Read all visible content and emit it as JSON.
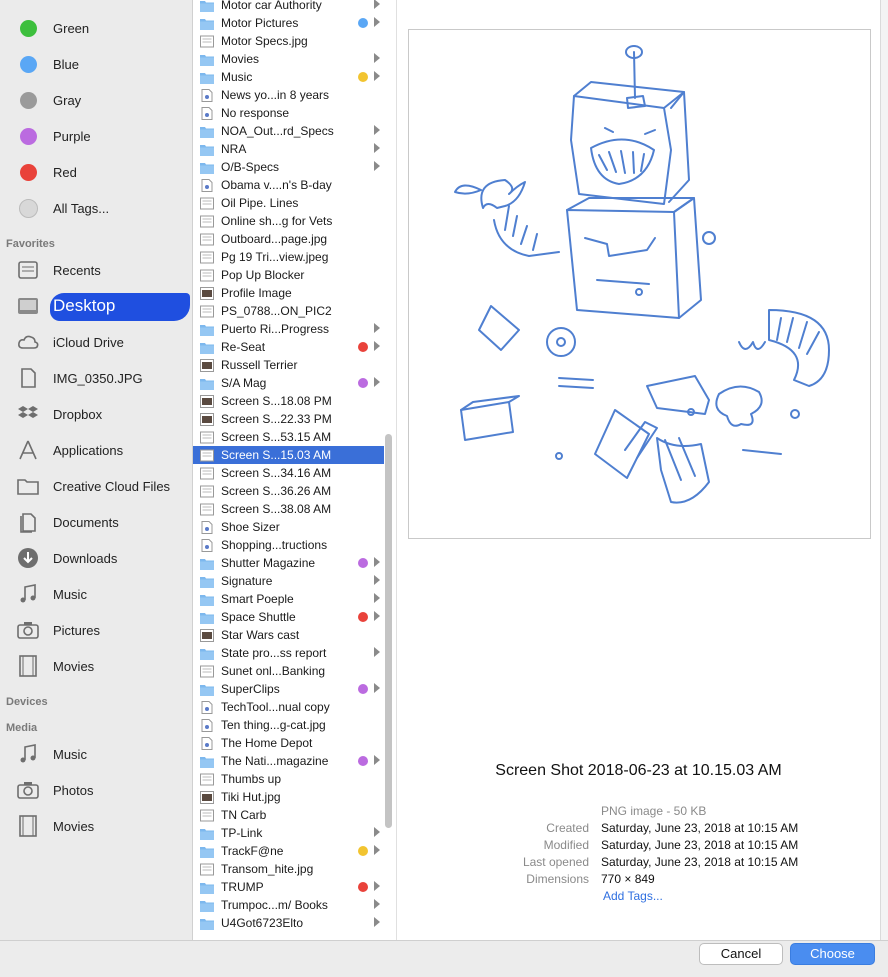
{
  "sidebar": {
    "tags": [
      {
        "label": "Green",
        "color": "#3dbf3d"
      },
      {
        "label": "Blue",
        "color": "#5aa7f5"
      },
      {
        "label": "Gray",
        "color": "#9a9a9a"
      },
      {
        "label": "Purple",
        "color": "#bb6be0"
      },
      {
        "label": "Red",
        "color": "#e9423a"
      },
      {
        "label": "All Tags...",
        "color": "#d8d8d8"
      }
    ],
    "favorites_header": "Favorites",
    "favorites": [
      {
        "label": "Recents",
        "icon": "recents-icon"
      },
      {
        "label": "Desktop",
        "icon": "desktop-icon",
        "selected": true
      },
      {
        "label": "iCloud Drive",
        "icon": "cloud-icon"
      },
      {
        "label": "IMG_0350.JPG",
        "icon": "document-icon"
      },
      {
        "label": "Dropbox",
        "icon": "dropbox-icon"
      },
      {
        "label": "Applications",
        "icon": "applications-icon"
      },
      {
        "label": "Creative Cloud Files",
        "icon": "folder-icon"
      },
      {
        "label": "Documents",
        "icon": "documents-icon"
      },
      {
        "label": "Downloads",
        "icon": "downloads-icon"
      },
      {
        "label": "Music",
        "icon": "music-icon"
      },
      {
        "label": "Pictures",
        "icon": "camera-icon"
      },
      {
        "label": "Movies",
        "icon": "film-icon"
      }
    ],
    "devices_header": "Devices",
    "media_header": "Media",
    "media": [
      {
        "label": "Music",
        "icon": "music-icon"
      },
      {
        "label": "Photos",
        "icon": "camera-icon"
      },
      {
        "label": "Movies",
        "icon": "film-icon"
      }
    ]
  },
  "files": [
    {
      "name": "Motor car Authority",
      "type": "folder",
      "arrow": true
    },
    {
      "name": "Motor Pictures",
      "type": "folder",
      "arrow": true,
      "tag": "#5aa7f5"
    },
    {
      "name": "Motor Specs.jpg",
      "type": "image"
    },
    {
      "name": "Movies",
      "type": "folder",
      "arrow": true
    },
    {
      "name": "Music",
      "type": "folder",
      "arrow": true,
      "tag": "#f2c430"
    },
    {
      "name": "News yo...in 8 years",
      "type": "doc"
    },
    {
      "name": "No response",
      "type": "doc"
    },
    {
      "name": "NOA_Out...rd_Specs",
      "type": "folder",
      "arrow": true
    },
    {
      "name": "NRA",
      "type": "folder",
      "arrow": true
    },
    {
      "name": "O/B-Specs",
      "type": "folder",
      "arrow": true
    },
    {
      "name": "Obama v....n's B-day",
      "type": "doc"
    },
    {
      "name": "Oil Pipe. Lines",
      "type": "image"
    },
    {
      "name": "Online sh...g for Vets",
      "type": "image"
    },
    {
      "name": "Outboard...page.jpg",
      "type": "image"
    },
    {
      "name": "Pg 19 Tri...view.jpeg",
      "type": "image"
    },
    {
      "name": "Pop Up Blocker",
      "type": "image"
    },
    {
      "name": "Profile Image",
      "type": "photo"
    },
    {
      "name": "PS_0788...ON_PIC2",
      "type": "image"
    },
    {
      "name": "Puerto Ri...Progress",
      "type": "folder",
      "arrow": true
    },
    {
      "name": "Re-Seat",
      "type": "folder",
      "arrow": true,
      "tag": "#e9423a"
    },
    {
      "name": "Russell Terrier",
      "type": "photo"
    },
    {
      "name": "S/A Mag",
      "type": "folder",
      "arrow": true,
      "tag": "#bb6be0"
    },
    {
      "name": "Screen S...18.08 PM",
      "type": "photo"
    },
    {
      "name": "Screen S...22.33 PM",
      "type": "photo"
    },
    {
      "name": "Screen S...53.15 AM",
      "type": "image"
    },
    {
      "name": "Screen S...15.03 AM",
      "type": "image",
      "selected": true
    },
    {
      "name": "Screen S...34.16 AM",
      "type": "image"
    },
    {
      "name": "Screen S...36.26 AM",
      "type": "image"
    },
    {
      "name": "Screen S...38.08 AM",
      "type": "image"
    },
    {
      "name": "Shoe Sizer",
      "type": "doc"
    },
    {
      "name": "Shopping...tructions",
      "type": "doc"
    },
    {
      "name": "Shutter Magazine",
      "type": "folder",
      "arrow": true,
      "tag": "#bb6be0"
    },
    {
      "name": "Signature",
      "type": "folder",
      "arrow": true
    },
    {
      "name": "Smart Poeple",
      "type": "folder",
      "arrow": true
    },
    {
      "name": "Space Shuttle",
      "type": "folder",
      "arrow": true,
      "tag": "#e9423a"
    },
    {
      "name": "Star Wars cast",
      "type": "photo"
    },
    {
      "name": "State pro...ss report",
      "type": "folder",
      "arrow": true
    },
    {
      "name": "Sunet onl...Banking",
      "type": "image"
    },
    {
      "name": "SuperClips",
      "type": "folder",
      "arrow": true,
      "tag": "#bb6be0"
    },
    {
      "name": "TechTool...nual copy",
      "type": "doc"
    },
    {
      "name": "Ten thing...g-cat.jpg",
      "type": "doc"
    },
    {
      "name": "The Home Depot",
      "type": "doc"
    },
    {
      "name": "The Nati...magazine",
      "type": "folder",
      "arrow": true,
      "tag": "#bb6be0"
    },
    {
      "name": "Thumbs up",
      "type": "image"
    },
    {
      "name": "Tiki Hut.jpg",
      "type": "photo"
    },
    {
      "name": "TN Carb",
      "type": "image"
    },
    {
      "name": "TP-Link",
      "type": "folder",
      "arrow": true
    },
    {
      "name": "TrackF@ne",
      "type": "folder",
      "arrow": true,
      "tag": "#f2c430"
    },
    {
      "name": "Transom_hite.jpg",
      "type": "image"
    },
    {
      "name": "TRUMP",
      "type": "folder",
      "arrow": true,
      "tag": "#e9423a"
    },
    {
      "name": "Trumpoc...m/ Books",
      "type": "folder",
      "arrow": true
    },
    {
      "name": "U4Got6723Elto",
      "type": "folder",
      "arrow": true
    }
  ],
  "preview": {
    "filename": "Screen Shot 2018-06-23 at 10.15.03 AM",
    "kind": "PNG image - 50 KB",
    "meta": [
      {
        "key": "Created",
        "value": "Saturday, June 23, 2018 at 10:15 AM"
      },
      {
        "key": "Modified",
        "value": "Saturday, June 23, 2018 at 10:15 AM"
      },
      {
        "key": "Last opened",
        "value": "Saturday, June 23, 2018 at 10:15 AM"
      },
      {
        "key": "Dimensions",
        "value": "770 × 849"
      }
    ],
    "add_tags": "Add Tags..."
  },
  "buttons": {
    "cancel": "Cancel",
    "choose": "Choose"
  },
  "colors": {
    "selection": "#3a6fd8",
    "sketch": "#4f7fd0"
  }
}
